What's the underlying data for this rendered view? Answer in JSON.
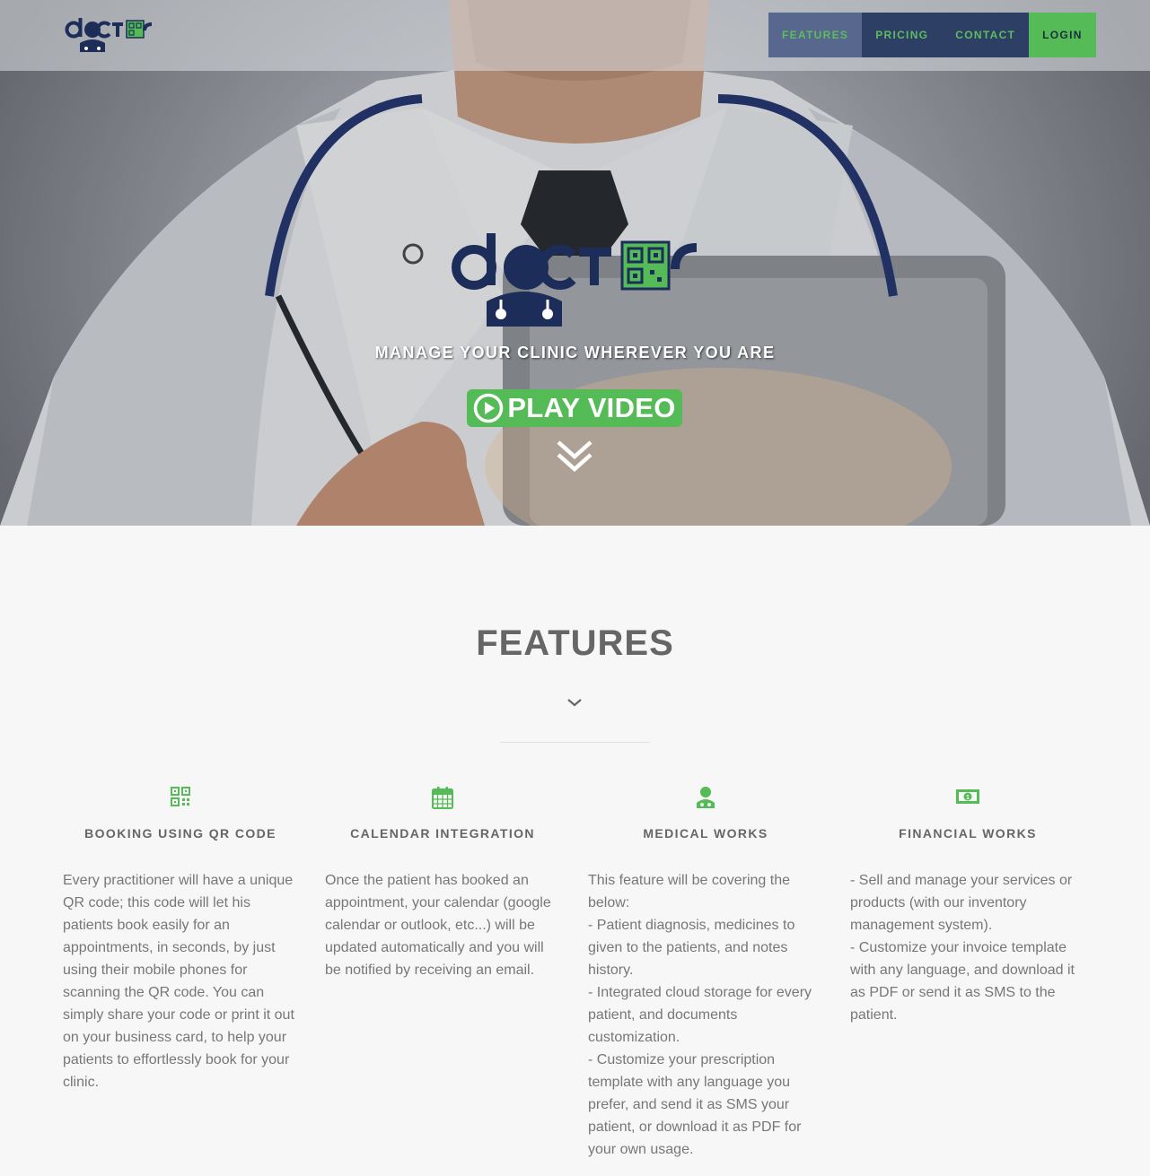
{
  "nav": {
    "logo_alt": "doctor",
    "items": [
      {
        "label": "FEATURES"
      },
      {
        "label": "PRICING"
      },
      {
        "label": "CONTACT"
      },
      {
        "label": "LOGIN"
      }
    ]
  },
  "hero": {
    "tagline": "MANAGE YOUR CLINIC WHEREVER YOU ARE",
    "play_label": "PLAY VIDEO",
    "play_icon": "play-circle-icon",
    "scroll_icon": "double-chevron-down-icon"
  },
  "features": {
    "title": "FEATURES",
    "items": [
      {
        "icon": "qr-code-icon",
        "title": "BOOKING USING QR CODE",
        "lines": [
          "Every practitioner will have a unique QR code; this code will let his patients book easily for an appointments, in seconds, by just using their mobile phones for scanning the QR code. You can simply share your code or print it out on your business card, to help your patients to effortlessly book for your clinic."
        ]
      },
      {
        "icon": "calendar-icon",
        "title": "CALENDAR INTEGRATION",
        "lines": [
          "Once the patient has booked an appointment, your calendar (google calendar or outlook, etc...) will be updated automatically and you will be notified by receiving an email."
        ]
      },
      {
        "icon": "doctor-icon",
        "title": "MEDICAL WORKS",
        "lines": [
          "This feature will be covering the below:",
          "- Patient diagnosis, medicines to given to the patients, and notes history.",
          "- Integrated cloud storage for every patient, and documents customization.",
          "- Customize your prescription template with any language you prefer, and send it as SMS your patient, or download it as PDF for your own usage."
        ]
      },
      {
        "icon": "money-icon",
        "title": "FINANCIAL WORKS",
        "lines": [
          "- Sell and manage your services or products (with our inventory management system).",
          "- Customize your invoice template with any language, and download it as PDF or send it as SMS to the patient."
        ]
      }
    ]
  },
  "colors": {
    "brand_green": "#55bb57",
    "brand_navy": "#1c2d59",
    "nav_bg": "#2e3f66"
  }
}
